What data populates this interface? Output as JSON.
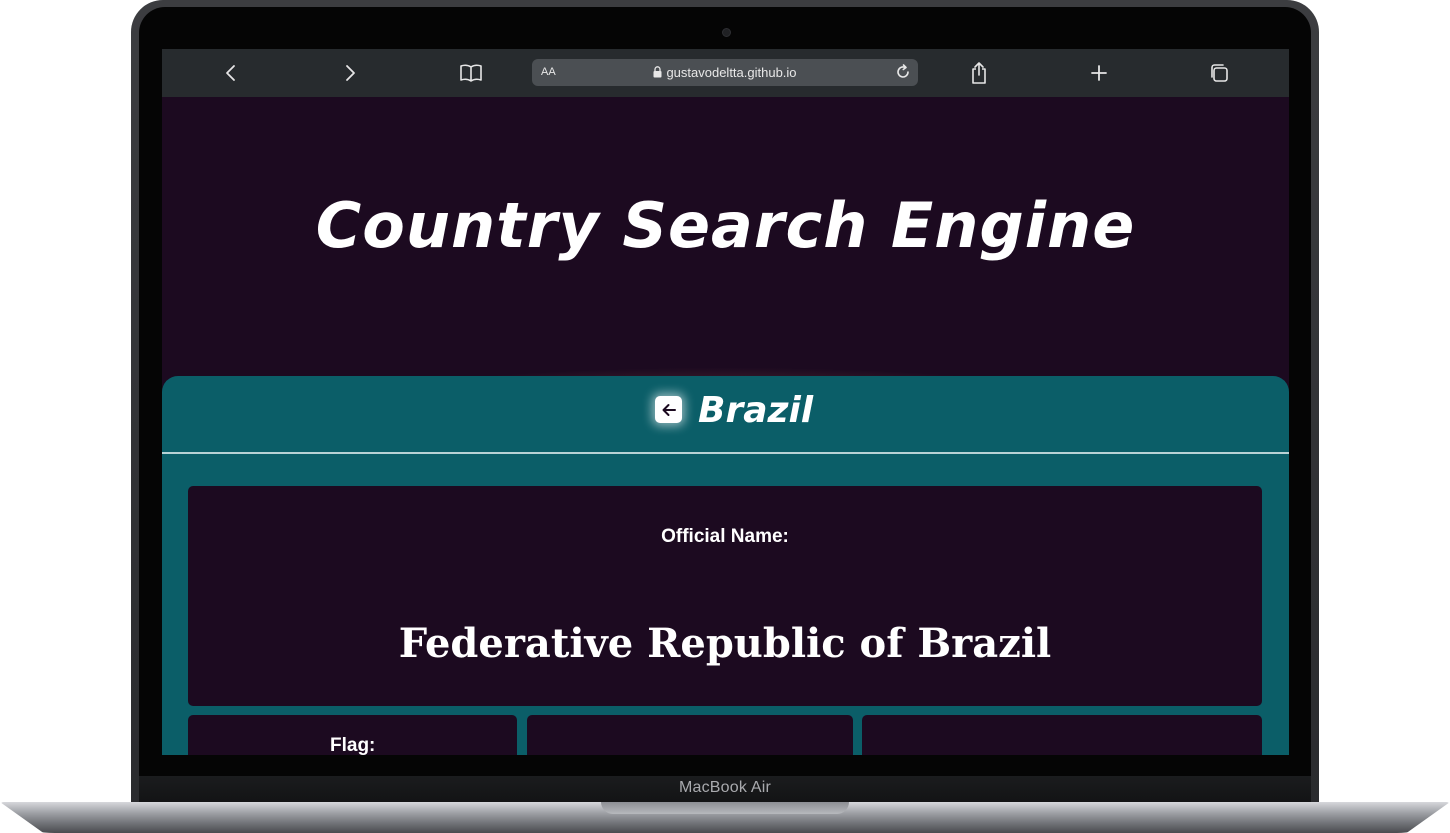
{
  "device": {
    "label": "MacBook Air"
  },
  "browser": {
    "address": {
      "aa_label": "AA",
      "url": "gustavodeltta.github.io"
    },
    "icons": [
      "back-icon",
      "forward-icon",
      "bookmarks-icon",
      "lock-icon",
      "reload-icon",
      "share-icon",
      "new-tab-icon",
      "tabs-icon"
    ]
  },
  "site": {
    "title": "Country Search Engine"
  },
  "country": {
    "name": "Brazil",
    "official_label": "Official Name:",
    "official_name": "Federative Republic of Brazil",
    "flag_label": "Flag:"
  },
  "colors": {
    "page_bg": "#1c0a20",
    "panel_bg": "#0b5e68",
    "toolbar_bg": "#272b2e",
    "glow": "#f28c64"
  }
}
